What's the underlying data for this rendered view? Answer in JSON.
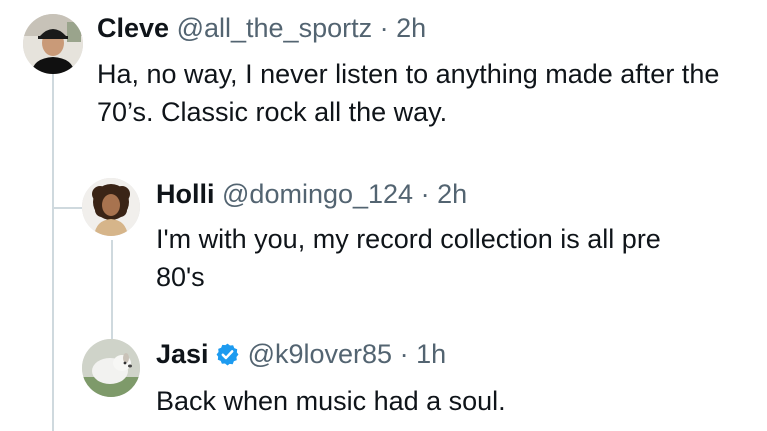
{
  "tweets": [
    {
      "name": "Cleve",
      "handle": "@all_the_sportz",
      "separator": "·",
      "time": "2h",
      "verified": false,
      "avatar_icon": "avatar-man-cap-icon",
      "text": "Ha, no way, I never listen to anything made after the 70’s. Classic rock all the way."
    },
    {
      "name": "Holli",
      "handle": "@domingo_124",
      "separator": "·",
      "time": "2h",
      "verified": false,
      "avatar_icon": "avatar-woman-curly-hair-icon",
      "text": "I'm with you, my record collection is all pre 80's"
    },
    {
      "name": "Jasi",
      "handle": "@k9lover85",
      "separator": "·",
      "time": "1h",
      "verified": true,
      "verified_color": "#1d9bf0",
      "avatar_icon": "avatar-dog-icon",
      "text": "Back when music had a soul."
    }
  ],
  "colors": {
    "text": "#0f1419",
    "secondary": "#536471",
    "thread_line": "#cfd9de",
    "verified": "#1d9bf0"
  }
}
